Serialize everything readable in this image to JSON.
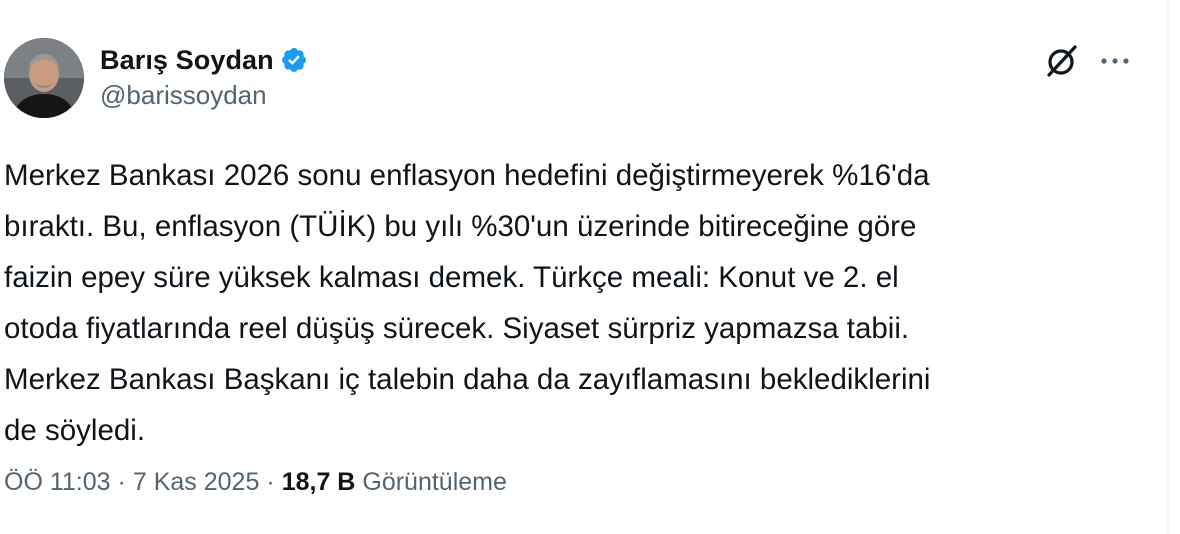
{
  "author": {
    "display_name": "Barış Soydan",
    "handle": "@barissoydan",
    "verified": true
  },
  "icons": {
    "avatar": "profile-photo",
    "verified": "verified-badge-icon",
    "grok": "grok-icon",
    "more": "more-options-icon"
  },
  "colors": {
    "verified_blue": "#1d9bf0",
    "text_primary": "#0f1419",
    "text_secondary": "#536471"
  },
  "tweet": {
    "lines": [
      "Merkez Bankası 2026 sonu enflasyon hedefini değiştirmeyerek %16'da",
      "bıraktı. Bu, enflasyon (TÜİK) bu yılı %30'un üzerinde bitireceğine göre",
      "faizin epey süre yüksek kalması demek. Türkçe meali: Konut ve 2. el",
      "otoda fiyatlarında reel düşüş sürecek. Siyaset sürpriz yapmazsa tabii.",
      "Merkez Bankası Başkanı iç talebin daha da zayıflamasını beklediklerini",
      "de söyledi."
    ]
  },
  "meta": {
    "time": "ÖÖ 11:03",
    "separator": "·",
    "date": "7 Kas 2025",
    "views_count": "18,7 B",
    "views_label": "Görüntüleme"
  }
}
